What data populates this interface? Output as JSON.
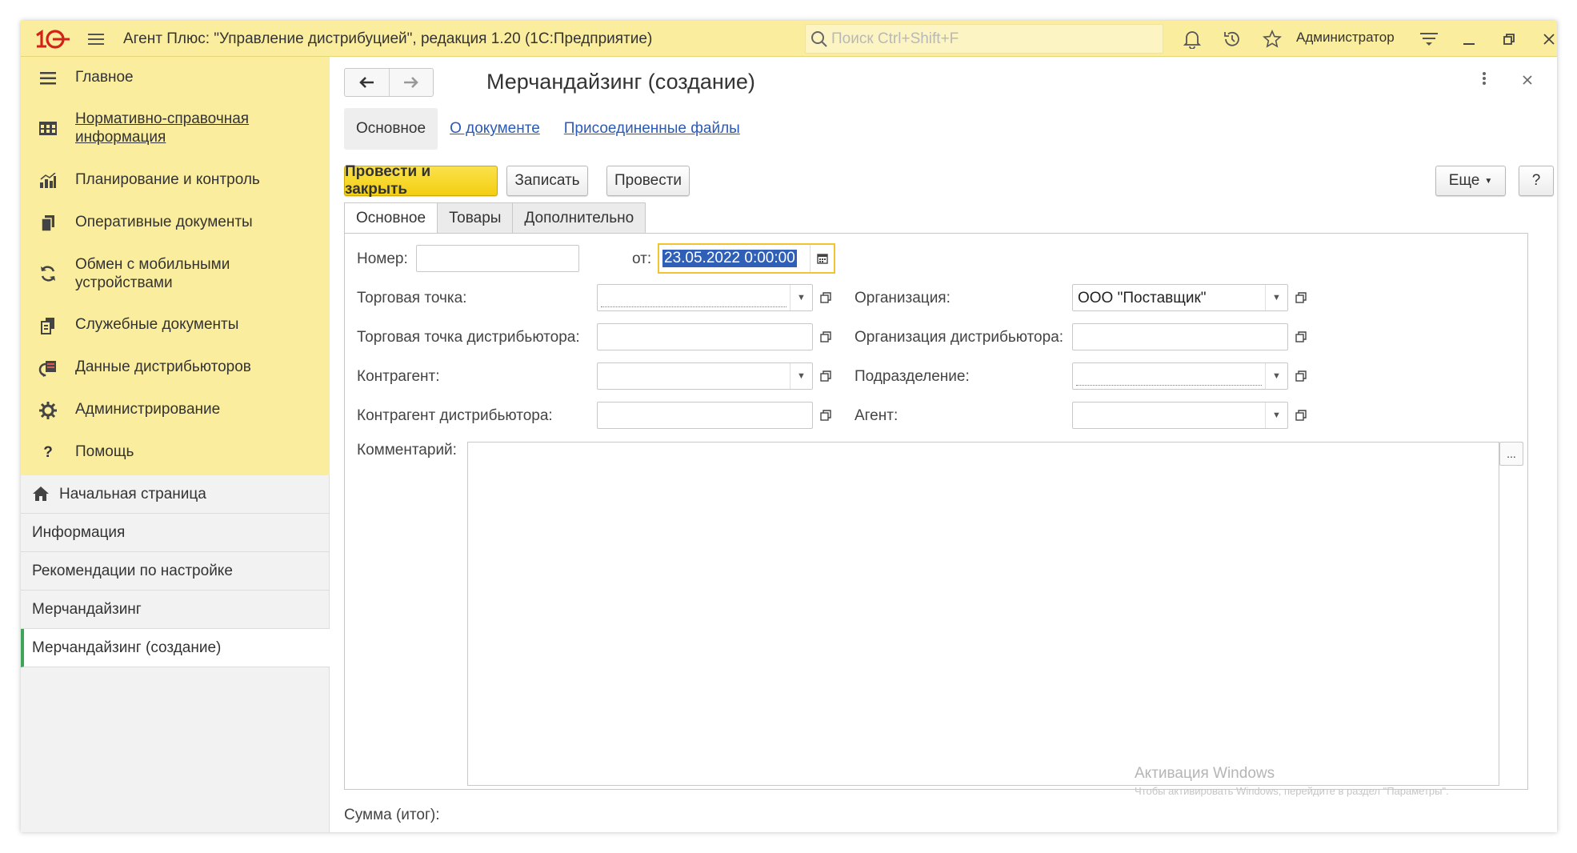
{
  "app": {
    "logo_text": "1С",
    "title": "Агент Плюс: \"Управление дистрибуцией\", редакция 1.20  (1С:Предприятие)",
    "search_placeholder": "Поиск Ctrl+Shift+F",
    "user": "Администратор"
  },
  "sidebar": {
    "sections": [
      {
        "label": "Главное",
        "icon": "menu-icon"
      },
      {
        "label": "Нормативно-справочная информация",
        "icon": "table-icon"
      },
      {
        "label": "Планирование и контроль",
        "icon": "chart-icon"
      },
      {
        "label": "Оперативные документы",
        "icon": "documents-icon"
      },
      {
        "label": "Обмен с мобильными устройствами",
        "icon": "sync-icon"
      },
      {
        "label": "Служебные документы",
        "icon": "service-docs-icon"
      },
      {
        "label": "Данные дистрибьюторов",
        "icon": "distributor-icon"
      },
      {
        "label": "Администрирование",
        "icon": "gear-icon"
      },
      {
        "label": "Помощь",
        "icon": "help-icon"
      }
    ],
    "open_windows": [
      {
        "label": "Начальная страница"
      },
      {
        "label": "Информация"
      },
      {
        "label": "Рекомендации по настройке"
      },
      {
        "label": "Мерчандайзинг"
      },
      {
        "label": "Мерчандайзинг (создание)"
      }
    ]
  },
  "form": {
    "title": "Мерчандайзинг (создание)",
    "top_tabs": [
      "Основное",
      "О документе",
      "Присоединенные файлы"
    ],
    "buttons": {
      "post_close": "Провести и закрыть",
      "save": "Записать",
      "post": "Провести",
      "more": "Еще",
      "help": "?"
    },
    "sub_tabs": [
      "Основное",
      "Товары",
      "Дополнительно"
    ],
    "fields": {
      "number_label": "Номер:",
      "number_value": "",
      "date_label": "от:",
      "date_value": "23.05.2022  0:00:00",
      "trade_point_label": "Торговая точка:",
      "trade_point_value": "",
      "organization_label": "Организация:",
      "organization_value": "ООО \"Поставщик\"",
      "trade_point_dist_label": "Торговая точка дистрибьютора:",
      "trade_point_dist_value": "",
      "organization_dist_label": "Организация дистрибьютора:",
      "organization_dist_value": "",
      "counterparty_label": "Контрагент:",
      "counterparty_value": "",
      "department_label": "Подразделение:",
      "department_value": "",
      "counterparty_dist_label": "Контрагент дистрибьютора:",
      "counterparty_dist_value": "",
      "agent_label": "Агент:",
      "agent_value": "",
      "comment_label": "Комментарий:",
      "comment_value": "",
      "comment_more": "..."
    },
    "total_label": "Сумма (итог):"
  },
  "watermark": {
    "title": "Активация Windows",
    "subtitle": "Чтобы активировать Windows, перейдите в раздел \"Параметры\"."
  }
}
